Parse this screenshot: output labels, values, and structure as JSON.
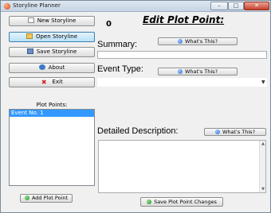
{
  "window": {
    "title": "Storyline Planner",
    "controls": {
      "minimize": "–",
      "maximize": "□",
      "close": "✕"
    }
  },
  "sidebar": {
    "buttons": [
      {
        "label": "New Storyline",
        "icon": "new-file-icon"
      },
      {
        "label": "Open Storyline",
        "icon": "folder-icon"
      },
      {
        "label": "Save Storyline",
        "icon": "save-icon"
      },
      {
        "label": "About",
        "icon": "info-icon"
      },
      {
        "label": "Exit",
        "icon": "exit-icon",
        "glyph": "✖"
      }
    ],
    "plot_points_label": "Plot Points:",
    "plot_points": [
      "Event No. 1"
    ],
    "add_button": "Add Plot Point"
  },
  "main": {
    "counter": "0",
    "heading": "Edit Plot Point:",
    "summary": {
      "label": "Summary:",
      "help": "What's This?",
      "value": ""
    },
    "event_type": {
      "label": "Event Type:",
      "help": "What's This?",
      "value": "",
      "arrow": "▼"
    },
    "description": {
      "label": "Detailed Description:",
      "help": "What's This?",
      "value": ""
    },
    "save_button": "Save Plot Point Changes"
  }
}
